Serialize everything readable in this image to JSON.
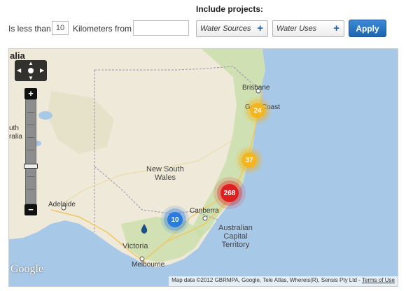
{
  "filter": {
    "projects_heading": "Include projects:",
    "less_than_label": "Is less than",
    "distance_value": "10",
    "km_from_label": "Kilometers from",
    "from_value": "",
    "projects": [
      {
        "label": "Water Sources",
        "icon": "plus-icon",
        "glyph": "+"
      },
      {
        "label": "Water Uses",
        "icon": "plus-icon",
        "glyph": "+"
      }
    ],
    "apply_label": "Apply"
  },
  "map": {
    "labels": {
      "top_left": "alia",
      "west_edge_1": "uth",
      "west_edge_2": "ralia",
      "brisbane": "Brisbane",
      "gold_coast": "Gold Coast",
      "nsw": "New South\nWales",
      "adelaide": "Adelaide",
      "canberra": "Canberra",
      "act": "Australian\nCapital\nTerritory",
      "victoria": "Victoria",
      "melbourne": "Melbourne"
    },
    "clusters": [
      {
        "count": "24",
        "color": "yellow"
      },
      {
        "count": "37",
        "color": "yellow"
      },
      {
        "count": "268",
        "color": "red"
      },
      {
        "count": "10",
        "color": "blue"
      }
    ],
    "zoom_in": "+",
    "zoom_out": "−",
    "google_logo": "Google",
    "attribution_text": "Map data ©2012 GBRMPA, Google, Tele Atlas, Whereis(R), Sensis Pty Ltd - ",
    "terms_link": "Terms of Use",
    "colors": {
      "sea": "#a8c8e8",
      "land": "#eee9d8",
      "forest": "#c9dfab",
      "cluster_yellow": "#f4b51e",
      "cluster_red": "#e02020",
      "cluster_blue": "#2a7be0",
      "apply_button": "#1f64ae"
    }
  }
}
